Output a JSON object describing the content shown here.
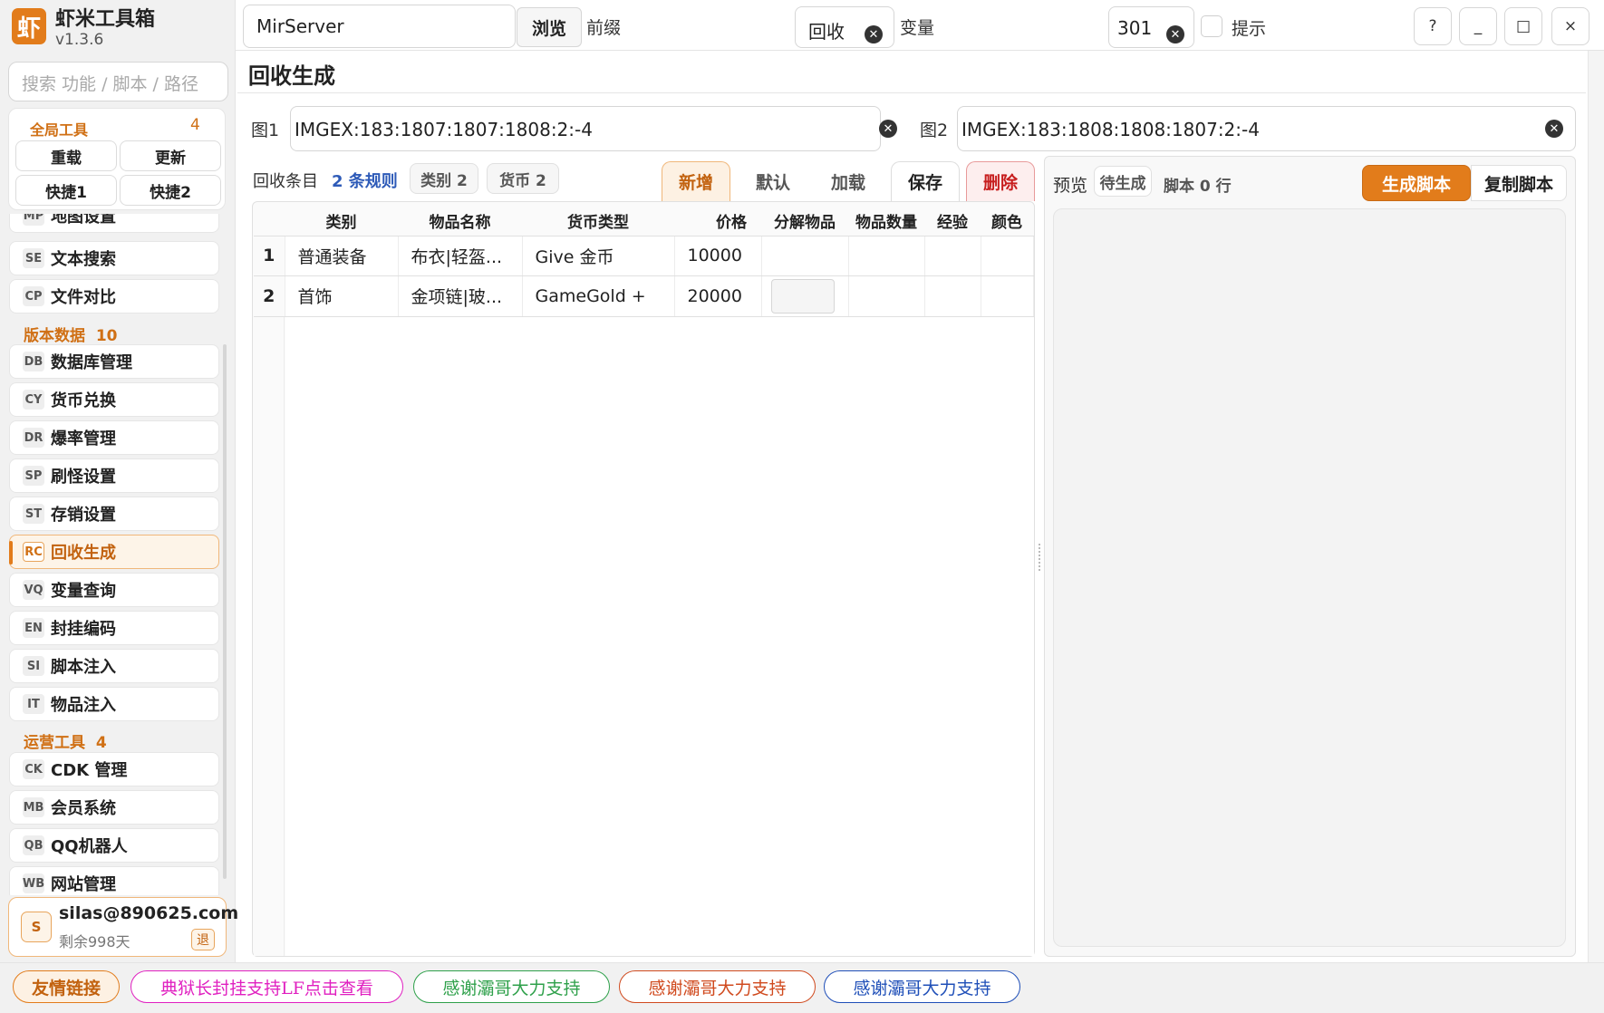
{
  "app": {
    "name": "虾米工具箱",
    "version": "v1.3.6",
    "logo_char": "虾"
  },
  "search": {
    "placeholder": "搜索 功能 / 脚本 / 路径"
  },
  "global_tools": {
    "title": "全局工具",
    "count": "4",
    "buttons": [
      "重载",
      "更新",
      "快捷1",
      "快捷2"
    ]
  },
  "nav": {
    "partial_top": {
      "code": "MP",
      "label": "地图设置"
    },
    "group1": [
      {
        "code": "SE",
        "label": "文本搜索"
      },
      {
        "code": "CP",
        "label": "文件对比"
      }
    ],
    "section2": {
      "title": "版本数据",
      "count": "10"
    },
    "group2": [
      {
        "code": "DB",
        "label": "数据库管理"
      },
      {
        "code": "CY",
        "label": "货币兑换"
      },
      {
        "code": "DR",
        "label": "爆率管理"
      },
      {
        "code": "SP",
        "label": "刷怪设置"
      },
      {
        "code": "ST",
        "label": "存销设置"
      },
      {
        "code": "RC",
        "label": "回收生成"
      },
      {
        "code": "VQ",
        "label": "变量查询"
      },
      {
        "code": "EN",
        "label": "封挂编码"
      },
      {
        "code": "SI",
        "label": "脚本注入"
      },
      {
        "code": "IT",
        "label": "物品注入"
      }
    ],
    "section3": {
      "title": "运营工具",
      "count": "4"
    },
    "group3": [
      {
        "code": "CK",
        "label": "CDK 管理"
      },
      {
        "code": "MB",
        "label": "会员系统"
      },
      {
        "code": "QB",
        "label": "QQ机器人"
      },
      {
        "code": "WB",
        "label": "网站管理"
      }
    ],
    "active": "RC"
  },
  "user": {
    "avatar": "S",
    "email": "silas@890625.com",
    "days_left": "剩余998天",
    "logout": "退"
  },
  "topbar": {
    "server_path": "MirServer",
    "browse": "浏览",
    "prefix_label": "前缀",
    "prefix_value": "回收",
    "var_label": "变量",
    "var_value": "301",
    "hint_label": "提示",
    "hint_checked": false,
    "win_buttons": [
      "?",
      "_",
      "□",
      "×"
    ]
  },
  "page": {
    "title": "回收生成"
  },
  "images": {
    "img1_label": "图1",
    "img1_value": "IMGEX:183:1807:1807:1808:2:-4",
    "img2_label": "图2",
    "img2_value": "IMGEX:183:1808:1808:1807:2:-4"
  },
  "rules": {
    "title": "回收条目",
    "rules_count": "2 条规则",
    "category_pill": "类别 2",
    "currency_pill": "货币 2",
    "tabs": [
      "新增",
      "默认",
      "加载",
      "保存",
      "删除"
    ],
    "columns": [
      "类别",
      "物品名称",
      "货币类型",
      "价格",
      "分解物品",
      "物品数量",
      "经验",
      "颜色"
    ],
    "rows": [
      {
        "index": "1",
        "category": "普通装备",
        "item": "布衣|轻盔...",
        "currency": "Give 金币",
        "price": "10000",
        "decompose": "",
        "qty": "",
        "exp": "",
        "color": ""
      },
      {
        "index": "2",
        "category": "首饰",
        "item": "金项链|玻...",
        "currency": "GameGold +",
        "price": "20000",
        "decompose": "",
        "qty": "",
        "exp": "",
        "color": ""
      }
    ]
  },
  "preview": {
    "label": "预览",
    "status": "待生成",
    "lines": "脚本 0 行",
    "generate": "生成脚本",
    "copy": "复制脚本"
  },
  "footer": {
    "links": [
      {
        "label": "友情链接",
        "color": "#c2620f"
      },
      {
        "label": "典狱长封挂支持LF点击查看",
        "color": "#e020c0"
      },
      {
        "label": "感谢灞哥大力支持",
        "color": "#2ea04a"
      },
      {
        "label": "感谢灞哥大力支持",
        "color": "#d04a1e"
      },
      {
        "label": "感谢灞哥大力支持",
        "color": "#1f4fb8"
      }
    ]
  },
  "colors": {
    "accent": "#e27c1b",
    "accent_dark": "#c2620f",
    "danger": "#d02020"
  }
}
